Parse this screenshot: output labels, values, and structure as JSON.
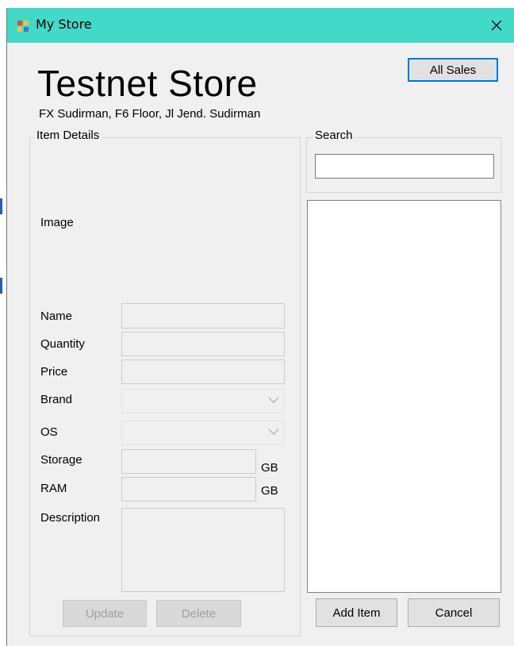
{
  "window": {
    "title": "My Store",
    "close_glyph": "✕",
    "icon": "app-window-icon"
  },
  "header": {
    "store_name": "Testnet Store",
    "address": "FX Sudirman, F6 Floor, Jl Jend. Sudirman",
    "all_sales_label": "All Sales"
  },
  "item_details": {
    "group_label": "Item Details",
    "image_label": "Image",
    "fields": {
      "name": "Name",
      "quantity": "Quantity",
      "price": "Price",
      "brand": "Brand",
      "os": "OS",
      "storage": "Storage",
      "ram": "RAM",
      "description": "Description"
    },
    "storage_unit": "GB",
    "ram_unit": "GB",
    "update_label": "Update",
    "delete_label": "Delete"
  },
  "search": {
    "group_label": "Search",
    "value": ""
  },
  "actions": {
    "add_label": "Add Item",
    "cancel_label": "Cancel"
  },
  "colors": {
    "titlebar": "#43d9c9",
    "accent": "#0078d7"
  }
}
